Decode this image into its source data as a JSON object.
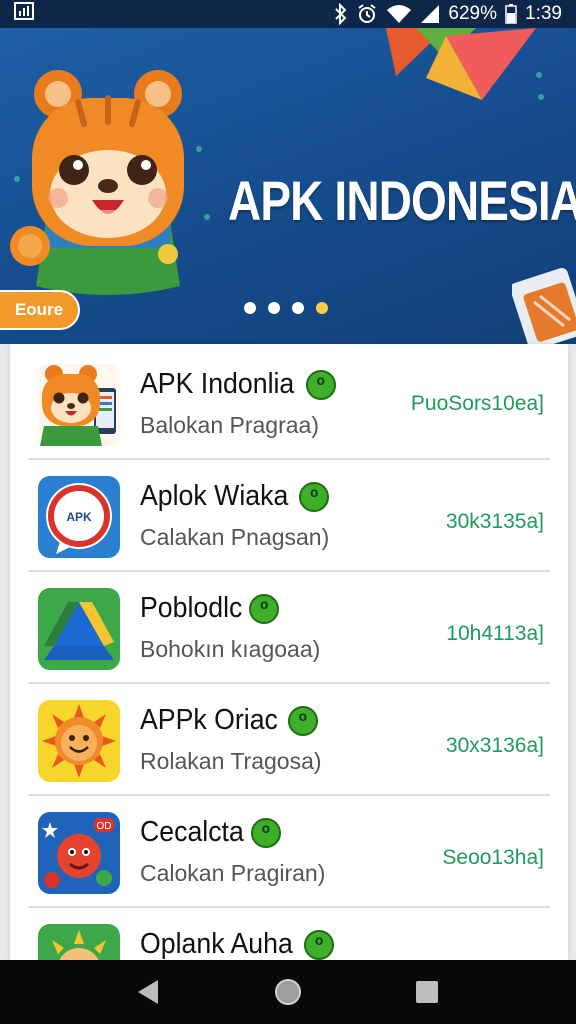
{
  "status_bar": {
    "battery_percent": "629%",
    "time": "1:39",
    "icons": [
      "notification-icon",
      "bluetooth-icon",
      "alarm-icon",
      "wifi-icon",
      "signal-icon",
      "battery-icon"
    ]
  },
  "banner": {
    "title": "APK INDONESIA",
    "badge_label": "Eoure",
    "slide_count": 4,
    "active_slide": 4,
    "colors": {
      "background": "#1a569b",
      "accent": "#f39a2d",
      "active_dot": "#f6cf4a"
    }
  },
  "apps": [
    {
      "name": "APK Indonlia",
      "badge": "ᵒ",
      "subtitle": "Balokan Pragraa)",
      "size": "PuoSors10ea]",
      "icon": "bear-mascot-icon"
    },
    {
      "name": "Aplok Wiaka",
      "badge": "ᵒ",
      "subtitle": "Calakan Pnagsan)",
      "size": "30k3135a]",
      "icon": "chat-bubble-icon"
    },
    {
      "name": "Poblodlc",
      "badge": "ᵒ",
      "subtitle": "Bohokın kıagoaa)",
      "size": "10h4113a]",
      "icon": "drive-triangle-icon"
    },
    {
      "name": "APPk Oriac",
      "badge": "ᵒ",
      "subtitle": "Rolakan Tragosa)",
      "size": "30x3136a]",
      "icon": "sun-face-icon"
    },
    {
      "name": "Cecalcta",
      "badge": "ᵒ",
      "subtitle": "Calokan Pragiran)",
      "size": "Seoo13ha]",
      "icon": "game-character-icon"
    },
    {
      "name": "Oplank Auha",
      "badge": "ᵒ",
      "subtitle": "",
      "size": "",
      "icon": "sun-character-icon"
    }
  ],
  "badges": [
    "ᵒ"
  ],
  "nav": {
    "buttons": [
      "back-icon",
      "home-icon",
      "recents-icon"
    ]
  }
}
